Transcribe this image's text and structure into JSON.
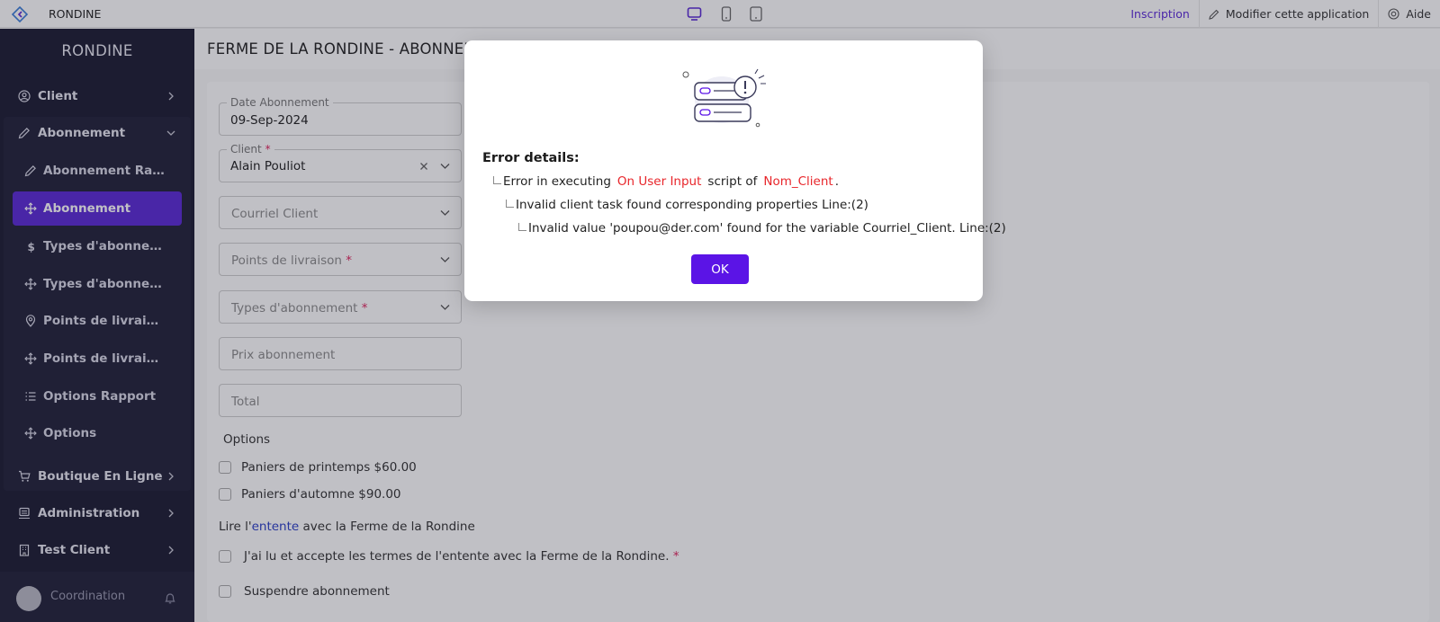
{
  "topbar": {
    "app_name": "RONDINE",
    "links": {
      "inscription": "Inscription",
      "modifier": "Modifier cette application",
      "aide": "Aide"
    }
  },
  "sidebar": {
    "title": "RONDINE",
    "items": {
      "client": "Client",
      "abonnement": "Abonnement",
      "boutique": "Boutique En Ligne",
      "administration": "Administration",
      "test_client": "Test Client"
    },
    "subitems": [
      {
        "label": "Abonnement Rapport",
        "icon": "pencil-icon"
      },
      {
        "label": "Abonnement",
        "icon": "plus-move-icon"
      },
      {
        "label": "Types d'abonnement Rapport",
        "icon": "dollar-icon"
      },
      {
        "label": "Types d'abonnement",
        "icon": "plus-move-icon"
      },
      {
        "label": "Points de livraison Rapport",
        "icon": "location-pin-icon"
      },
      {
        "label": "Points de livraison",
        "icon": "plus-move-icon"
      },
      {
        "label": "Options Rapport",
        "icon": "list-icon"
      },
      {
        "label": "Options",
        "icon": "plus-move-icon"
      }
    ],
    "user": "Coordination"
  },
  "main": {
    "page_title": "FERME DE LA RONDINE - ABONNEMENT",
    "form": {
      "date_label": "Date Abonnement",
      "date_value": "09-Sep-2024",
      "client_label": "Client",
      "client_value": "Alain Pouliot",
      "courriel_placeholder": "Courriel Client",
      "points_placeholder": "Points de livraison",
      "types_placeholder": "Types d'abonnement",
      "prix_placeholder": "Prix abonnement",
      "total_placeholder": "Total",
      "options_title": "Options",
      "option_1": "Paniers de printemps $60.00",
      "option_2": "Paniers d'automne $90.00",
      "agree_prefix": "Lire l'",
      "agree_link": "entente",
      "agree_suffix": " avec la Ferme de la Rondine",
      "accept_label": "J'ai lu et accepte les termes de l'entente avec la Ferme de la Rondine.",
      "suspend_label": "Suspendre abonnement"
    }
  },
  "modal": {
    "title": "Error details:",
    "line1_a": "Error in executing",
    "line1_red1": "On User Input",
    "line1_b": "script of",
    "line1_red2": "Nom_Client",
    "line1_c": ".",
    "line2": "Invalid client task found corresponding properties Line:(2)",
    "line3": "Invalid value 'poupou@der.com' found for the variable Courriel_Client. Line:(2)",
    "ok_label": "OK"
  },
  "colors": {
    "accent": "#5b14e6",
    "sidebar_bg": "#1d1d33",
    "error_red": "#e8262b"
  }
}
